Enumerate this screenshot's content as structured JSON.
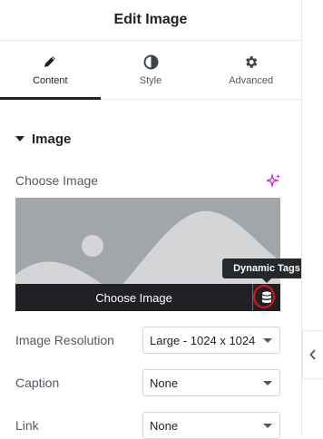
{
  "header": {
    "title": "Edit Image"
  },
  "tabs": [
    {
      "label": "Content",
      "icon": "pencil-icon",
      "active": true
    },
    {
      "label": "Style",
      "icon": "half-circle-icon",
      "active": false
    },
    {
      "label": "Advanced",
      "icon": "gear-icon",
      "active": false
    }
  ],
  "section": {
    "title": "Image",
    "icon": "caret-down-icon"
  },
  "choose_image": {
    "label": "Choose Image",
    "button_label": "Choose Image",
    "ai_icon": "sparkle-icon",
    "dynamic_icon": "database-icon"
  },
  "tooltip": {
    "text": "Dynamic Tags"
  },
  "fields": {
    "resolution": {
      "label": "Image Resolution",
      "value": "Large - 1024 x 1024"
    },
    "caption": {
      "label": "Caption",
      "value": "None"
    },
    "link": {
      "label": "Link",
      "value": "None"
    }
  },
  "colors": {
    "accent_ai": "#c026d3",
    "highlight_ring": "#e3131b",
    "placeholder_bg": "#a2a5aa",
    "dark_bar": "#1f2124"
  }
}
